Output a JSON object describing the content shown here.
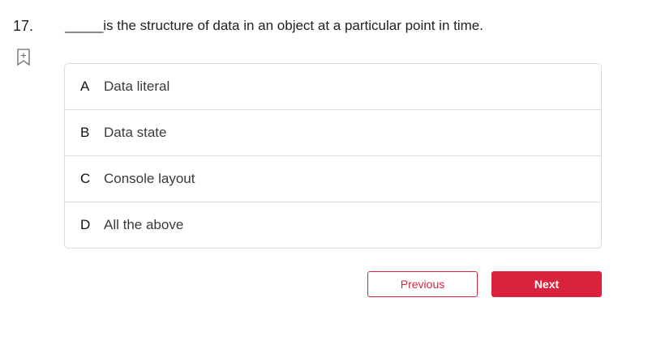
{
  "question": {
    "number": "17.",
    "text": "_____is the structure of data in an object at a particular point in time."
  },
  "bookmark": {
    "icon": "bookmark-add-icon"
  },
  "options": [
    {
      "letter": "A",
      "text": "Data literal"
    },
    {
      "letter": "B",
      "text": "Data state"
    },
    {
      "letter": "C",
      "text": "Console layout"
    },
    {
      "letter": "D",
      "text": "All the above"
    }
  ],
  "navigation": {
    "previous_label": "Previous",
    "next_label": "Next"
  },
  "colors": {
    "accent": "#d9233c",
    "border": "#dcdcdc"
  }
}
